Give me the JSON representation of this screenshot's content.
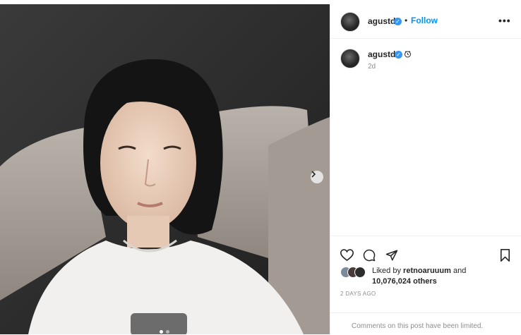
{
  "post": {
    "username": "agustd",
    "follow_label": "Follow",
    "bullet": "•",
    "more_label": "•••",
    "caption_username": "agustd",
    "time_ago": "2d",
    "likes_prefix": "Liked by",
    "liked_by_user": "retnoaruuum",
    "likes_and": "and",
    "likes_count": "10,076,024 others",
    "date": "2 DAYS AGO",
    "comments_limited": "Comments on this post have been limited."
  },
  "carousel": {
    "total": 2,
    "current": 1
  },
  "icons": {
    "verified": "verified-badge-icon",
    "like": "heart-icon",
    "comment": "comment-icon",
    "share": "share-icon",
    "save": "bookmark-icon",
    "next": "chevron-right-icon",
    "clock": "clock-icon"
  },
  "colors": {
    "link": "#0095f6",
    "verified": "#3897f0",
    "muted": "#8e8e8e",
    "text": "#262626"
  }
}
